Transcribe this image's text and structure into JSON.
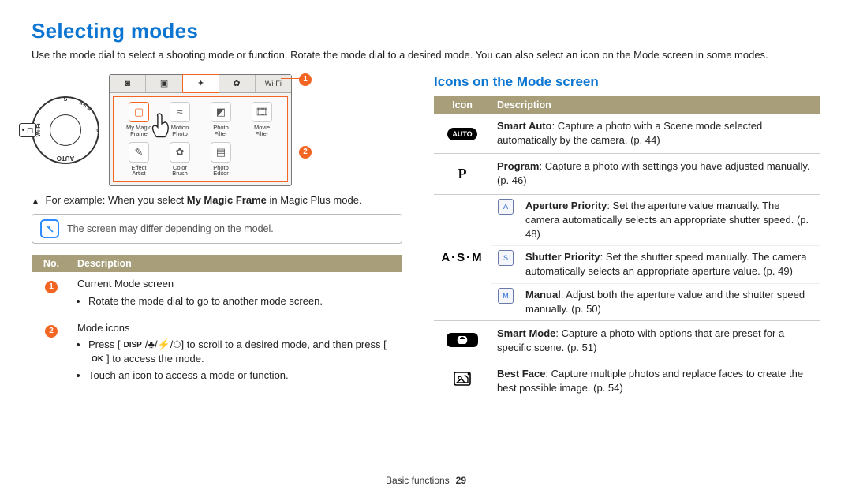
{
  "page": {
    "title": "Selecting modes",
    "intro": "Use the mode dial to select a shooting mode or function. Rotate the mode dial to a desired mode. You can also select an icon on the Mode screen in some modes.",
    "footer_section": "Basic functions",
    "footer_page": "29"
  },
  "dial": {
    "marks": {
      "top": "S",
      "tr": "A·S·M",
      "right": "P",
      "bottom": "AUTO",
      "left": "Wi-Fi"
    }
  },
  "mode_screen": {
    "tabs": [
      {
        "label_icon": "camera-icon",
        "text": ""
      },
      {
        "label_icon": "picture-icon",
        "text": ""
      },
      {
        "label_icon": "magic-icon",
        "text": ""
      },
      {
        "label_icon": "gear-icon",
        "text": ""
      },
      {
        "label_icon": "",
        "text": "Wi-Fi"
      }
    ],
    "icons": [
      {
        "name": "My Magic\nFrame",
        "selected": true
      },
      {
        "name": "Motion\nPhoto"
      },
      {
        "name": "Photo\nFilter"
      },
      {
        "name": "Movie\nFilter"
      },
      {
        "name": "Effect\nArtist"
      },
      {
        "name": "Color\nBrush"
      },
      {
        "name": "Photo\nEditor"
      }
    ]
  },
  "callouts": {
    "c1": "1",
    "c2": "2"
  },
  "example_line": {
    "prefix": "For example: When you select ",
    "bold": "My Magic Frame",
    "suffix": " in Magic Plus mode."
  },
  "note": "The screen may differ depending on the model.",
  "no_desc_table": {
    "headers": [
      "No.",
      "Description"
    ],
    "rows": [
      {
        "no": "1",
        "title": "Current Mode screen",
        "items": [
          "Rotate the mode dial to go to another mode screen."
        ]
      },
      {
        "no": "2",
        "title": "Mode icons",
        "press_prefix": "Press [",
        "press_btn": "DISP",
        "press_mid": "/",
        "press_mid2": "/",
        "press_mid3": "/",
        "press_suffix1": "] to scroll to a desired mode, and then press [",
        "press_ok": "OK",
        "press_suffix2": "] to access the mode.",
        "items2": [
          "Touch an icon to access a mode or function."
        ]
      }
    ]
  },
  "right": {
    "subtitle": "Icons on the Mode screen",
    "headers": [
      "Icon",
      "Description"
    ],
    "rows": [
      {
        "icon_type": "auto",
        "icon_text": "AUTO",
        "desc_bold": "Smart Auto",
        "desc_rest": ": Capture a photo with a Scene mode selected automatically by the camera. (p. 44)"
      },
      {
        "icon_type": "p",
        "icon_text": "P",
        "desc_bold": "Program",
        "desc_rest": ": Capture a photo with settings you have adjusted manually. (p. 46)"
      },
      {
        "icon_type": "asm",
        "icon_text": "A·S·M",
        "sub": [
          {
            "glyph": "A",
            "bold": "Aperture Priority",
            "rest": ": Set the aperture value manually. The camera automatically selects an appropriate shutter speed. (p. 48)"
          },
          {
            "glyph": "S",
            "bold": "Shutter Priority",
            "rest": ": Set the shutter speed manually. The camera automatically selects an appropriate aperture value. (p. 49)"
          },
          {
            "glyph": "M",
            "bold": "Manual",
            "rest": ": Adjust both the aperture value and the shutter speed manually. (p. 50)"
          }
        ]
      },
      {
        "icon_type": "smart",
        "icon_text": "S",
        "desc_bold": "Smart Mode",
        "desc_rest": ": Capture a photo with options that are preset for a specific scene. (p. 51)"
      },
      {
        "icon_type": "bestface",
        "icon_text": "",
        "desc_bold": "Best Face",
        "desc_rest": ": Capture multiple photos and replace faces to create the best possible image. (p. 54)"
      }
    ]
  }
}
